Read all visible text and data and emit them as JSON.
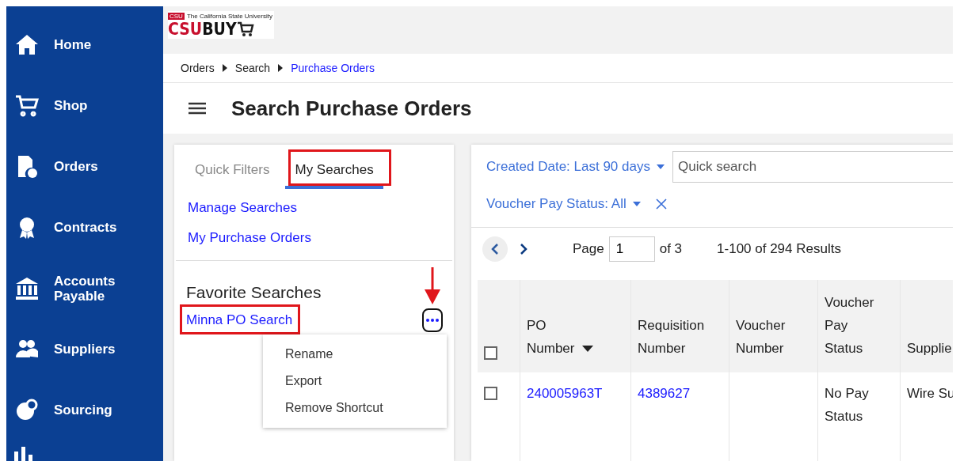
{
  "sidebar": {
    "items": [
      {
        "label": "Home"
      },
      {
        "label": "Shop"
      },
      {
        "label": "Orders"
      },
      {
        "label": "Contracts"
      },
      {
        "label": "Accounts Payable"
      },
      {
        "label": "Suppliers"
      },
      {
        "label": "Sourcing"
      }
    ]
  },
  "logo": {
    "tagline": "The California State University",
    "mark": "CSU",
    "name_red": "CSU",
    "name_dark": "BUY"
  },
  "breadcrumb": [
    {
      "label": "Orders",
      "current": false
    },
    {
      "label": "Search",
      "current": false
    },
    {
      "label": "Purchase Orders",
      "current": true
    }
  ],
  "page_title": "Search Purchase Orders",
  "filter_panel": {
    "tabs": [
      {
        "label": "Quick Filters",
        "selected": false,
        "highlighted": false
      },
      {
        "label": "My Searches",
        "selected": true,
        "highlighted": true
      }
    ],
    "links": [
      "Manage Searches",
      "My Purchase Orders"
    ],
    "favorites_heading": "Favorite Searches",
    "favorites": [
      {
        "label": "Minna PO Search",
        "highlighted": true,
        "menu_pointed": true
      }
    ],
    "menu": {
      "open": true,
      "items": [
        "Rename",
        "Export",
        "Remove Shortcut"
      ]
    }
  },
  "results": {
    "filters": [
      {
        "label": "Created Date: Last 90 days",
        "removable": false
      },
      {
        "label": "Voucher Pay Status: All",
        "removable": true
      }
    ],
    "search": {
      "placeholder": "Quick search"
    },
    "pager": {
      "page_label": "Page",
      "page": "1",
      "of": "of 3",
      "summary": "1-100 of 294 Results"
    },
    "all_checked": false,
    "columns": [
      {
        "label": "PO Number",
        "sorted": true
      },
      {
        "label": "Requisition Number"
      },
      {
        "label": "Voucher Number"
      },
      {
        "label": "Voucher Pay Status"
      },
      {
        "label": "Supplie"
      }
    ],
    "rows": [
      {
        "checked": false,
        "cells": [
          {
            "kind": "link",
            "text": "240005963T"
          },
          {
            "kind": "link",
            "text": "4389627"
          },
          {
            "kind": "empty"
          },
          {
            "kind": "text",
            "text": "No Pay Status"
          },
          {
            "kind": "text",
            "text": "Wire Su"
          }
        ]
      }
    ]
  }
}
